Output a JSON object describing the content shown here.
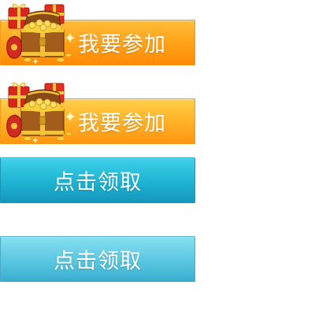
{
  "buttons": {
    "join_1": {
      "label": "我要参加",
      "icon": "treasure-chest-icon"
    },
    "join_2": {
      "label": "我要参加",
      "icon": "treasure-chest-icon"
    },
    "claim_1": {
      "label": "点击领取"
    },
    "claim_2": {
      "label": "点击领取"
    }
  },
  "colors": {
    "orange_top": "#ffbe3a",
    "orange_bottom": "#ff8a06",
    "blue_top": "#3fd0e8",
    "blue_bottom": "#1497bd",
    "light_blue_top": "#86dff0",
    "light_blue_bottom": "#3aaed0"
  }
}
